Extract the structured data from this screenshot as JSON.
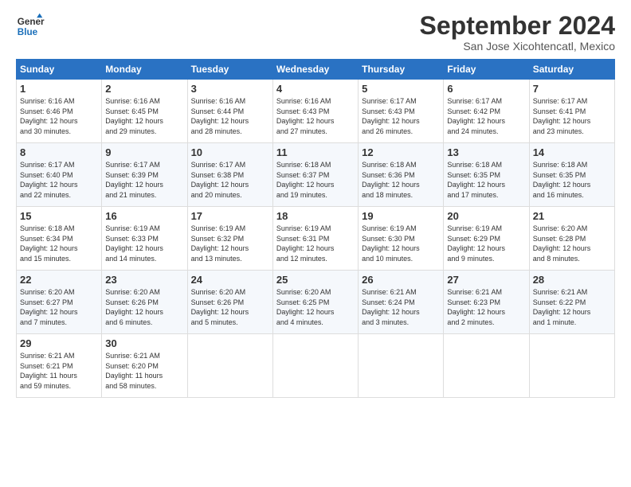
{
  "logo": {
    "line1": "General",
    "line2": "Blue"
  },
  "title": "September 2024",
  "location": "San Jose Xicohtencatl, Mexico",
  "days_of_week": [
    "Sunday",
    "Monday",
    "Tuesday",
    "Wednesday",
    "Thursday",
    "Friday",
    "Saturday"
  ],
  "weeks": [
    [
      {
        "day": "1",
        "info": "Sunrise: 6:16 AM\nSunset: 6:46 PM\nDaylight: 12 hours\nand 30 minutes."
      },
      {
        "day": "2",
        "info": "Sunrise: 6:16 AM\nSunset: 6:45 PM\nDaylight: 12 hours\nand 29 minutes."
      },
      {
        "day": "3",
        "info": "Sunrise: 6:16 AM\nSunset: 6:44 PM\nDaylight: 12 hours\nand 28 minutes."
      },
      {
        "day": "4",
        "info": "Sunrise: 6:16 AM\nSunset: 6:43 PM\nDaylight: 12 hours\nand 27 minutes."
      },
      {
        "day": "5",
        "info": "Sunrise: 6:17 AM\nSunset: 6:43 PM\nDaylight: 12 hours\nand 26 minutes."
      },
      {
        "day": "6",
        "info": "Sunrise: 6:17 AM\nSunset: 6:42 PM\nDaylight: 12 hours\nand 24 minutes."
      },
      {
        "day": "7",
        "info": "Sunrise: 6:17 AM\nSunset: 6:41 PM\nDaylight: 12 hours\nand 23 minutes."
      }
    ],
    [
      {
        "day": "8",
        "info": "Sunrise: 6:17 AM\nSunset: 6:40 PM\nDaylight: 12 hours\nand 22 minutes."
      },
      {
        "day": "9",
        "info": "Sunrise: 6:17 AM\nSunset: 6:39 PM\nDaylight: 12 hours\nand 21 minutes."
      },
      {
        "day": "10",
        "info": "Sunrise: 6:17 AM\nSunset: 6:38 PM\nDaylight: 12 hours\nand 20 minutes."
      },
      {
        "day": "11",
        "info": "Sunrise: 6:18 AM\nSunset: 6:37 PM\nDaylight: 12 hours\nand 19 minutes."
      },
      {
        "day": "12",
        "info": "Sunrise: 6:18 AM\nSunset: 6:36 PM\nDaylight: 12 hours\nand 18 minutes."
      },
      {
        "day": "13",
        "info": "Sunrise: 6:18 AM\nSunset: 6:35 PM\nDaylight: 12 hours\nand 17 minutes."
      },
      {
        "day": "14",
        "info": "Sunrise: 6:18 AM\nSunset: 6:35 PM\nDaylight: 12 hours\nand 16 minutes."
      }
    ],
    [
      {
        "day": "15",
        "info": "Sunrise: 6:18 AM\nSunset: 6:34 PM\nDaylight: 12 hours\nand 15 minutes."
      },
      {
        "day": "16",
        "info": "Sunrise: 6:19 AM\nSunset: 6:33 PM\nDaylight: 12 hours\nand 14 minutes."
      },
      {
        "day": "17",
        "info": "Sunrise: 6:19 AM\nSunset: 6:32 PM\nDaylight: 12 hours\nand 13 minutes."
      },
      {
        "day": "18",
        "info": "Sunrise: 6:19 AM\nSunset: 6:31 PM\nDaylight: 12 hours\nand 12 minutes."
      },
      {
        "day": "19",
        "info": "Sunrise: 6:19 AM\nSunset: 6:30 PM\nDaylight: 12 hours\nand 10 minutes."
      },
      {
        "day": "20",
        "info": "Sunrise: 6:19 AM\nSunset: 6:29 PM\nDaylight: 12 hours\nand 9 minutes."
      },
      {
        "day": "21",
        "info": "Sunrise: 6:20 AM\nSunset: 6:28 PM\nDaylight: 12 hours\nand 8 minutes."
      }
    ],
    [
      {
        "day": "22",
        "info": "Sunrise: 6:20 AM\nSunset: 6:27 PM\nDaylight: 12 hours\nand 7 minutes."
      },
      {
        "day": "23",
        "info": "Sunrise: 6:20 AM\nSunset: 6:26 PM\nDaylight: 12 hours\nand 6 minutes."
      },
      {
        "day": "24",
        "info": "Sunrise: 6:20 AM\nSunset: 6:26 PM\nDaylight: 12 hours\nand 5 minutes."
      },
      {
        "day": "25",
        "info": "Sunrise: 6:20 AM\nSunset: 6:25 PM\nDaylight: 12 hours\nand 4 minutes."
      },
      {
        "day": "26",
        "info": "Sunrise: 6:21 AM\nSunset: 6:24 PM\nDaylight: 12 hours\nand 3 minutes."
      },
      {
        "day": "27",
        "info": "Sunrise: 6:21 AM\nSunset: 6:23 PM\nDaylight: 12 hours\nand 2 minutes."
      },
      {
        "day": "28",
        "info": "Sunrise: 6:21 AM\nSunset: 6:22 PM\nDaylight: 12 hours\nand 1 minute."
      }
    ],
    [
      {
        "day": "29",
        "info": "Sunrise: 6:21 AM\nSunset: 6:21 PM\nDaylight: 11 hours\nand 59 minutes."
      },
      {
        "day": "30",
        "info": "Sunrise: 6:21 AM\nSunset: 6:20 PM\nDaylight: 11 hours\nand 58 minutes."
      },
      {
        "day": "",
        "info": ""
      },
      {
        "day": "",
        "info": ""
      },
      {
        "day": "",
        "info": ""
      },
      {
        "day": "",
        "info": ""
      },
      {
        "day": "",
        "info": ""
      }
    ]
  ]
}
